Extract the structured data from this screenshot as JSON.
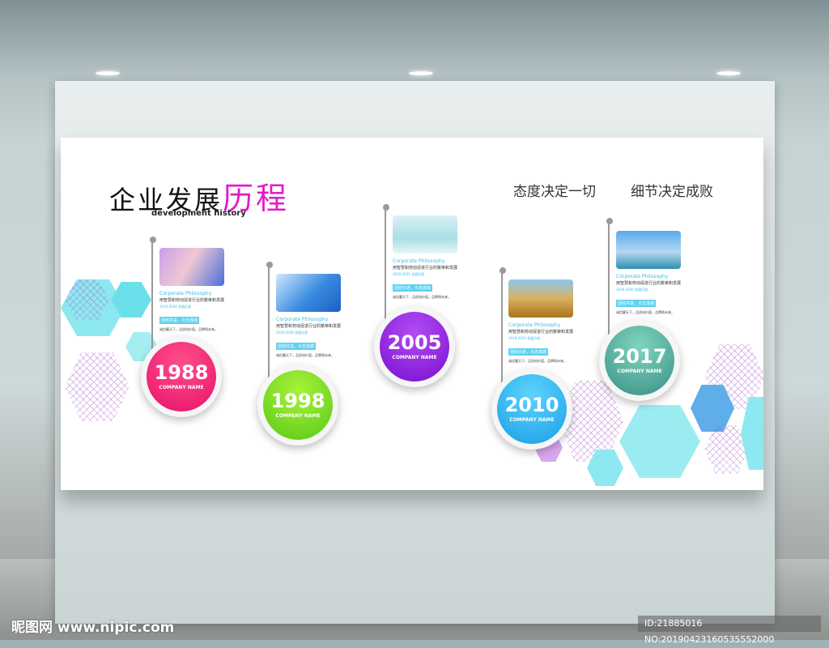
{
  "board": {
    "title_main": "企业发展",
    "title_highlight": "历程",
    "subtitle": "development history",
    "slogan_1": "态度决定一切",
    "slogan_2": "细节决定成败"
  },
  "milestones": [
    {
      "year": "1988",
      "company": "COMPANY NAME",
      "color": "#e8106a",
      "heading": "Corporate Philosophy",
      "line": "用智慧和劳动促进行业的繁荣和发展",
      "small": "2019-2020 发展历程",
      "badge": "团结共进，众志成城",
      "desc": "诚信赢天下，品质创价值，品牌铸未来。"
    },
    {
      "year": "1998",
      "company": "COMPANY NAME",
      "color": "#6fd41a",
      "heading": "Corporate Philosophy",
      "line": "用智慧和劳动促进行业的繁荣和发展",
      "small": "2019-2020 发展历程",
      "badge": "团结共进，众志成城",
      "desc": "诚信赢天下，品质创价值，品牌铸未来。"
    },
    {
      "year": "2005",
      "company": "COMPANY NAME",
      "color": "#8a12d8",
      "heading": "Corporate Philosophy",
      "line": "用智慧和劳动促进行业的繁荣和发展",
      "small": "2019-2020 发展历程",
      "badge": "团结共进，众志成城",
      "desc": "诚信赢天下，品质创价值，品牌铸未来。"
    },
    {
      "year": "2010",
      "company": "COMPANY NAME",
      "color": "#1aa8ec",
      "heading": "Corporate Philosophy",
      "line": "用智慧和劳动促进行业的繁荣和发展",
      "small": "2019-2020 发展历程",
      "badge": "团结共进，众志成城",
      "desc": "诚信赢天下，品质创价值，品牌铸未来。"
    },
    {
      "year": "2017",
      "company": "COMPANY NAME",
      "color": "#3f9e8a",
      "heading": "Corporate Philosophy",
      "line": "用智慧和劳动促进行业的繁荣和发展",
      "small": "2019-2020 发展历程",
      "badge": "团结共进，众志成城",
      "desc": "诚信赢天下，品质创价值，品牌铸未来。"
    }
  ],
  "watermark": {
    "site": "昵图网 www.nipic.com",
    "id": "ID:21885016 NO:20190423160535552000"
  }
}
